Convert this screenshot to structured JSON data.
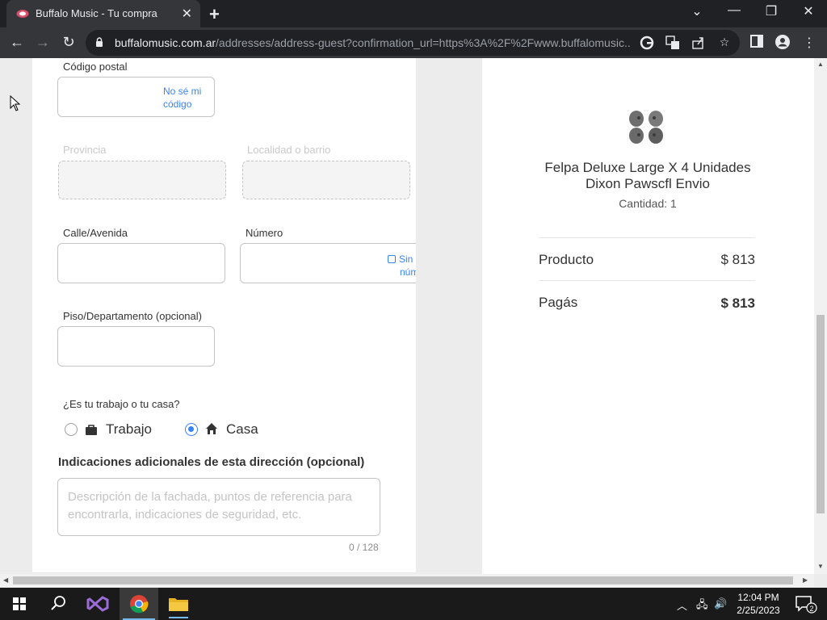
{
  "browser": {
    "tab_title": "Buffalo Music - Tu compra",
    "url_host": "buffalomusic.com.ar",
    "url_path": "/addresses/address-guest?confirmation_url=https%3A%2F%2Fwww.buffalomusic...."
  },
  "form": {
    "postal_code_label": "Código postal",
    "postal_code_value": "",
    "no_se_codigo_line1": "No sé mi",
    "no_se_codigo_line2": "código",
    "provincia_label": "Provincia",
    "localidad_label": "Localidad o barrio",
    "calle_label": "Calle/Avenida",
    "numero_label": "Número",
    "sin_numero_line1": "Sin",
    "sin_numero_line2": "núm",
    "piso_label": "Piso/Departamento (opcional)",
    "work_or_home_question": "¿Es tu trabajo o tu casa?",
    "option_trabajo": "Trabajo",
    "option_casa": "Casa",
    "selected_option": "Casa",
    "indicaciones_title": "Indicaciones adicionales de esta dirección (opcional)",
    "indicaciones_placeholder": "Descripción de la fachada, puntos de referencia para encontrarla, indicaciones de seguridad, etc.",
    "char_counter": "0 / 128"
  },
  "summary": {
    "product_title": "Felpa Deluxe Large X 4 Unidades Dixon Pawscfl Envio",
    "quantity": "Cantidad: 1",
    "producto_label": "Producto",
    "producto_value": "$ 813",
    "pagas_label": "Pagás",
    "pagas_value": "$ 813"
  },
  "taskbar": {
    "time": "12:04 PM",
    "date": "2/25/2023",
    "notification_count": "2"
  },
  "colors": {
    "accent": "#3483fa",
    "chrome_dark": "#202124",
    "chrome_toolbar": "#35363a"
  }
}
